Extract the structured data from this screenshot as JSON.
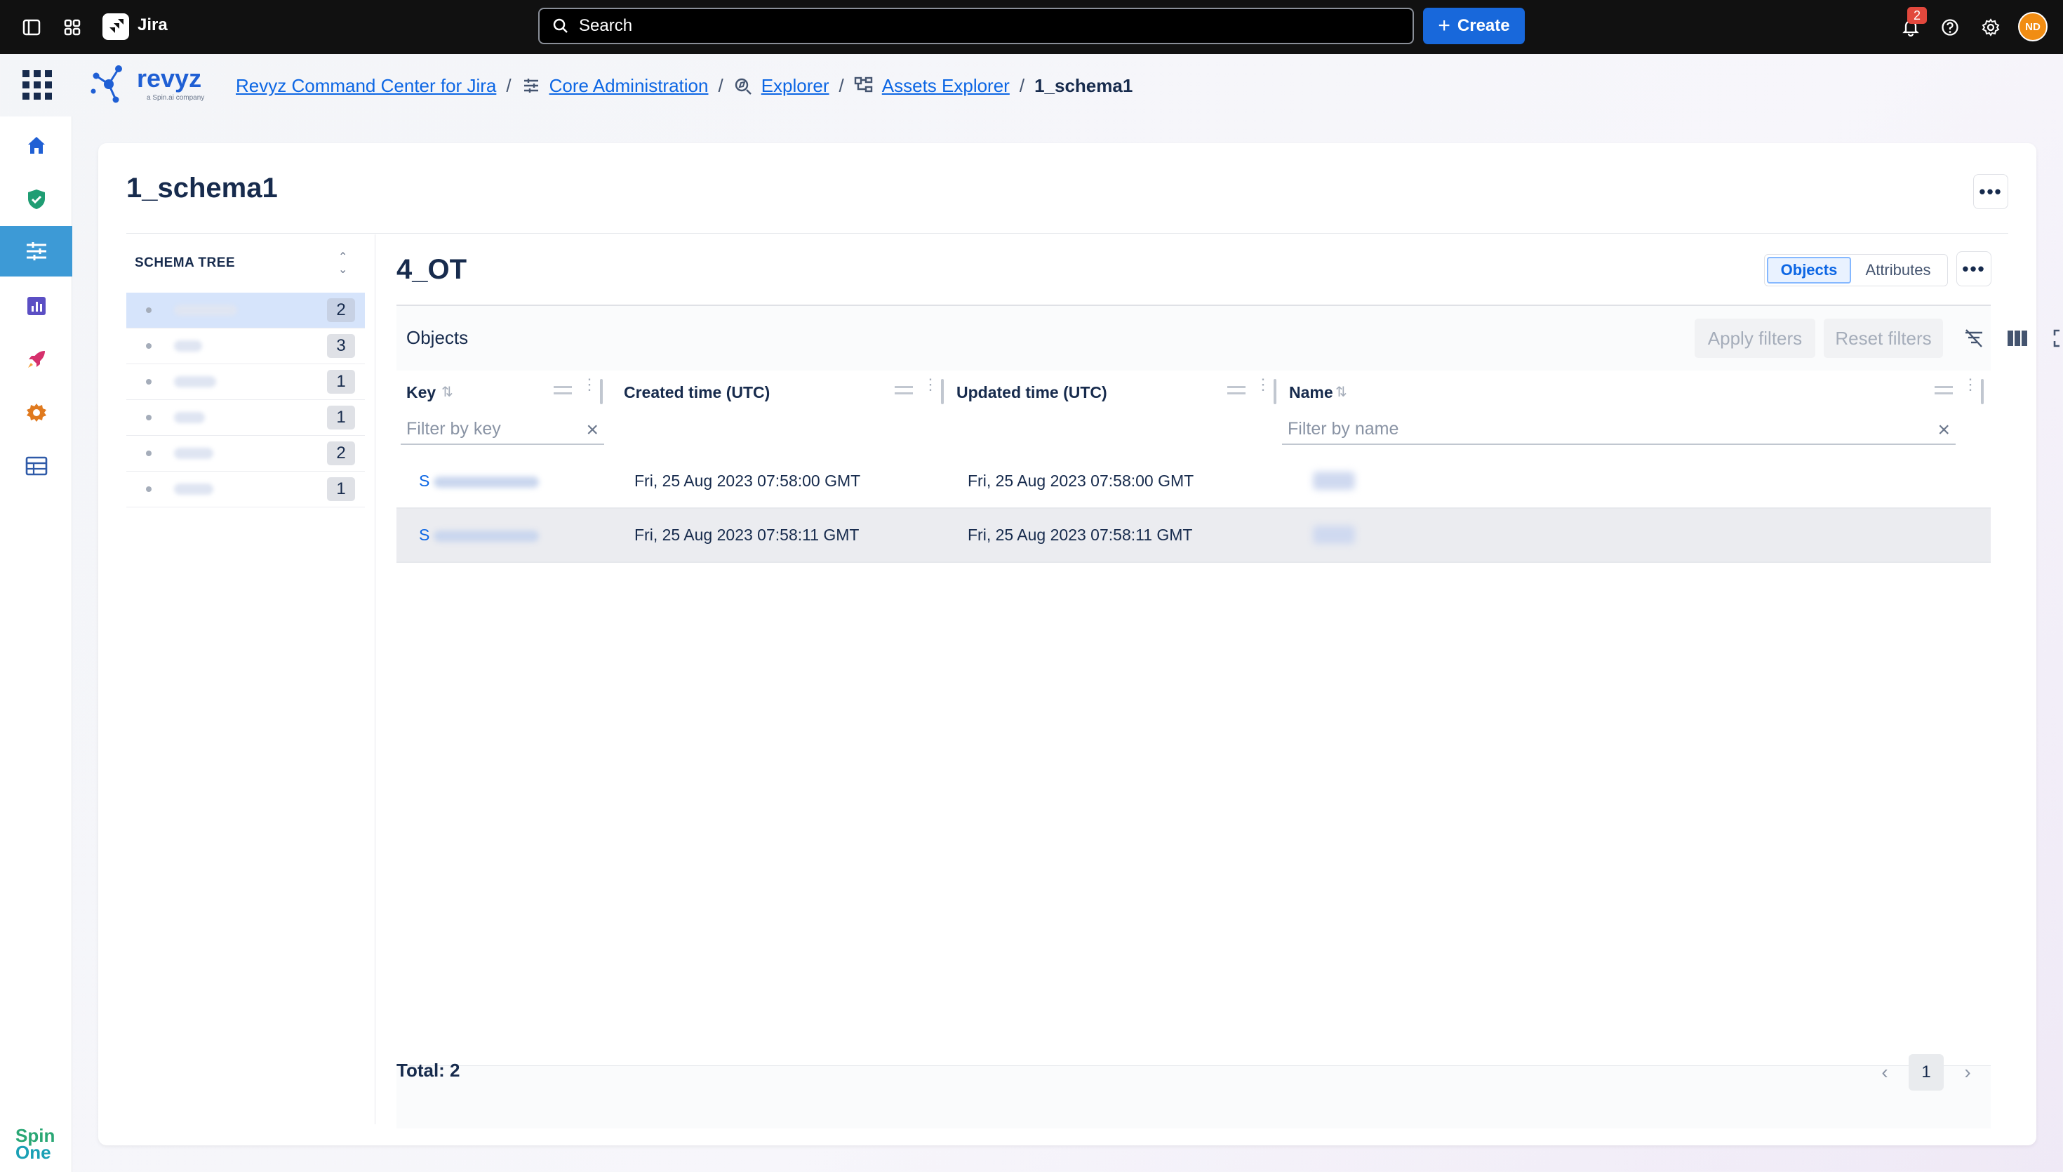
{
  "topbar": {
    "app_name": "Jira",
    "search_placeholder": "Search",
    "create_label": "Create",
    "notification_count": "2",
    "avatar_initials": "ND"
  },
  "breadcrumb": {
    "items": [
      {
        "label": "Revyz Command Center for Jira",
        "icon": "none"
      },
      {
        "label": "Core Administration",
        "icon": "sliders-icon"
      },
      {
        "label": "Explorer",
        "icon": "explore-icon"
      },
      {
        "label": "Assets Explorer",
        "icon": "hierarchy-icon"
      }
    ],
    "current": "1_schema1"
  },
  "brand": {
    "logo_text": "revyz",
    "logo_sub": "a Spin.ai company",
    "footer_logo_line1": "Spin",
    "footer_logo_line2": "One"
  },
  "rail": {
    "icons": [
      "home-icon",
      "shield-icon",
      "sliders-icon",
      "chart-icon",
      "rocket-icon",
      "gear-icon",
      "table-icon"
    ],
    "active_index": 2
  },
  "page": {
    "title": "1_schema1"
  },
  "schema_tree": {
    "heading": "SCHEMA TREE",
    "items": [
      {
        "count": "2",
        "selected": true
      },
      {
        "count": "3",
        "selected": false
      },
      {
        "count": "1",
        "selected": false
      },
      {
        "count": "1",
        "selected": false
      },
      {
        "count": "2",
        "selected": false
      },
      {
        "count": "1",
        "selected": false
      }
    ]
  },
  "object_type": {
    "title": "4_OT",
    "tabs": [
      "Objects",
      "Attributes"
    ],
    "active_tab": "Objects"
  },
  "table": {
    "title": "Objects",
    "apply_filters": "Apply filters",
    "reset_filters": "Reset filters",
    "columns": [
      {
        "label": "Key",
        "filter_placeholder": "Filter by key"
      },
      {
        "label": "Created time (UTC)"
      },
      {
        "label": "Updated time (UTC)"
      },
      {
        "label": "Name",
        "filter_placeholder": "Filter by name"
      }
    ],
    "rows": [
      {
        "key_prefix": "S",
        "created": "Fri, 25 Aug 2023 07:58:00 GMT",
        "updated": "Fri, 25 Aug 2023 07:58:00 GMT",
        "highlighted": false
      },
      {
        "key_prefix": "S",
        "created": "Fri, 25 Aug 2023 07:58:11 GMT",
        "updated": "Fri, 25 Aug 2023 07:58:11 GMT",
        "highlighted": true
      }
    ],
    "total_label": "Total: 2",
    "current_page": "1"
  },
  "colors": {
    "accent": "#1868db",
    "link": "#0c66e4",
    "rail_active": "#3d9ad6",
    "avatar": "#f18d13"
  }
}
